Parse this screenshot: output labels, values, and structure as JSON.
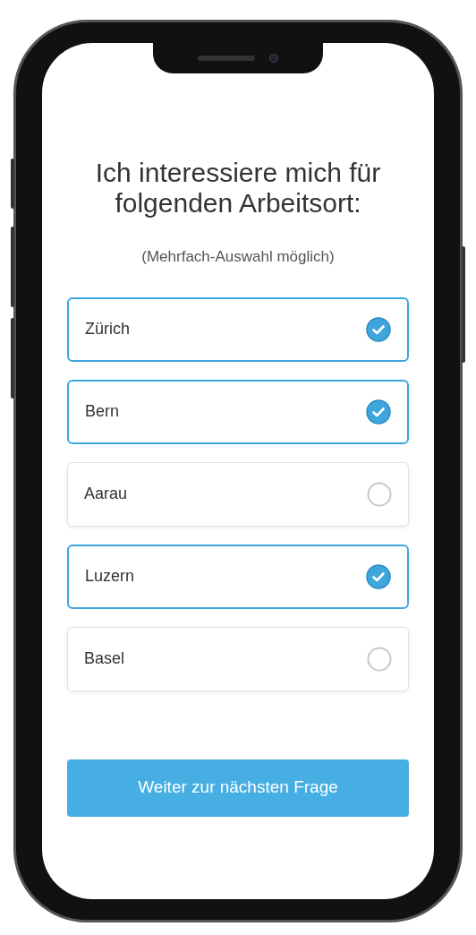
{
  "question": {
    "title": "Ich interessiere mich für folgenden Arbeitsort:",
    "hint": "(Mehrfach-Auswahl möglich)"
  },
  "options": [
    {
      "label": "Zürich",
      "selected": true
    },
    {
      "label": "Bern",
      "selected": true
    },
    {
      "label": "Aarau",
      "selected": false
    },
    {
      "label": "Luzern",
      "selected": true
    },
    {
      "label": "Basel",
      "selected": false
    }
  ],
  "next_button": {
    "label": "Weiter zur nächsten Frage"
  }
}
